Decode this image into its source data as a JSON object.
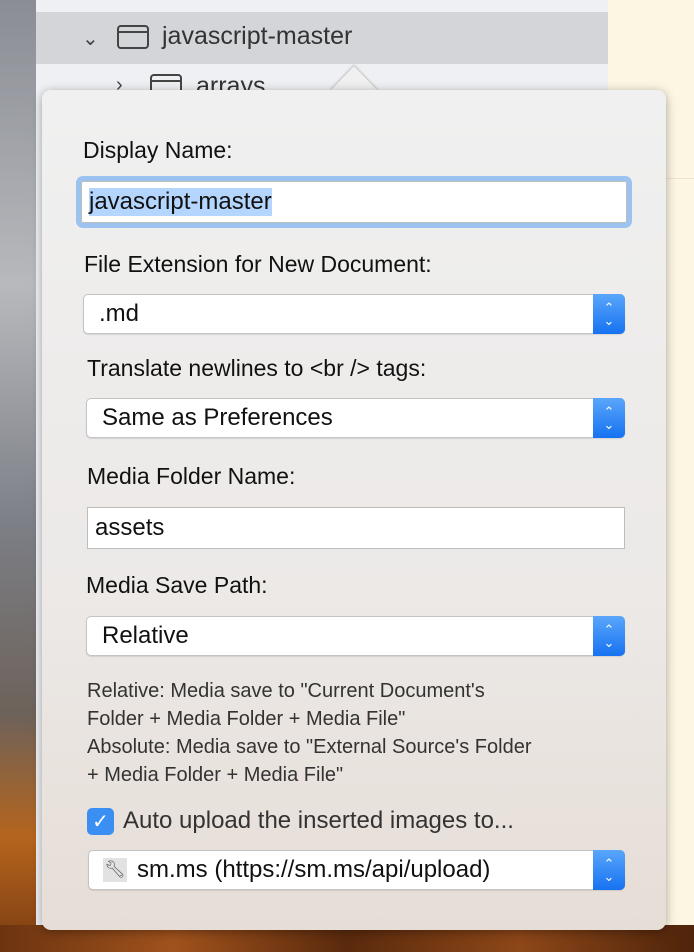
{
  "sidebar": {
    "items": [
      {
        "label": "javascript-master",
        "expanded": true,
        "selected": true
      },
      {
        "label": "arrays",
        "expanded": false
      }
    ]
  },
  "popover": {
    "display_name_label": "Display Name:",
    "display_name_value": "javascript-master",
    "file_ext_label": "File Extension for New Document:",
    "file_ext_value": ".md",
    "newlines_label": "Translate newlines to <br /> tags:",
    "newlines_value": "Same as Preferences",
    "media_folder_label": "Media Folder Name:",
    "media_folder_value": "assets",
    "media_path_label": "Media Save Path:",
    "media_path_value": "Relative",
    "help_lines": [
      "Relative: Media save to \"Current Document's",
      "Folder + Media Folder + Media File\"",
      "Absolute: Media save to \"External Source's Folder",
      "+ Media Folder + Media File\""
    ],
    "auto_upload_label": "Auto upload the inserted images to...",
    "auto_upload_checked": true,
    "upload_service_value": "sm.ms (https://sm.ms/api/upload)",
    "upload_service_icon": "wrench-icon"
  },
  "colors": {
    "accent": "#3b8ff3",
    "selection": "#b4d5fe",
    "focus_ring": "#9cc3ef"
  }
}
